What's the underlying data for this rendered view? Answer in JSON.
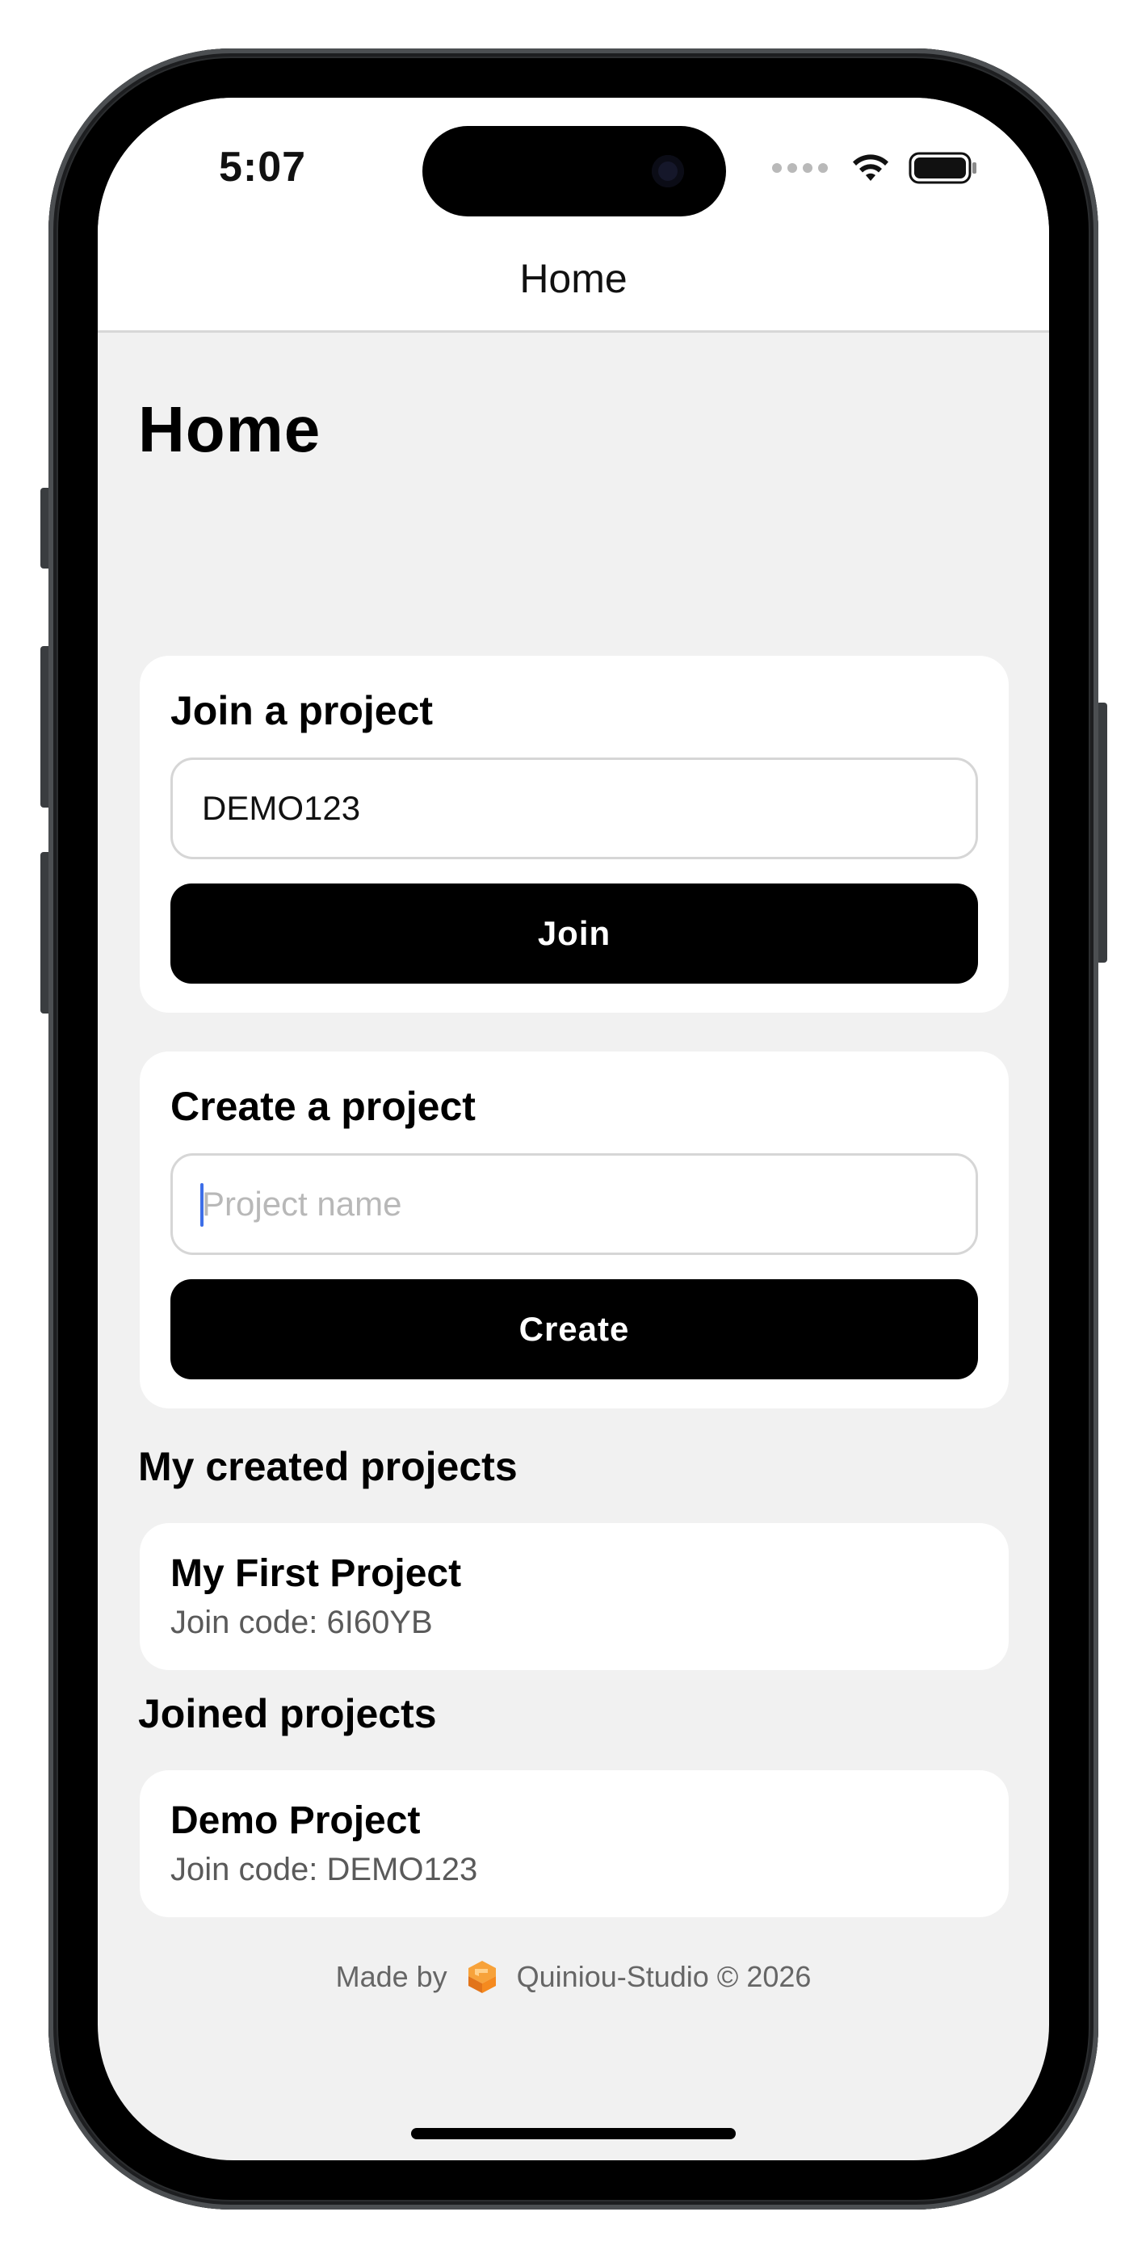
{
  "status_bar": {
    "time": "5:07"
  },
  "nav": {
    "title": "Home"
  },
  "page": {
    "title": "Home"
  },
  "join_card": {
    "heading": "Join a project",
    "input_value": "DEMO123",
    "button_label": "Join"
  },
  "create_card": {
    "heading": "Create a project",
    "input_placeholder": "Project name",
    "button_label": "Create"
  },
  "created_section": {
    "heading": "My created projects",
    "items": [
      {
        "name": "My First Project",
        "code": "Join code: 6I60YB"
      }
    ]
  },
  "joined_section": {
    "heading": "Joined projects",
    "items": [
      {
        "name": "Demo Project",
        "code": "Join code: DEMO123"
      }
    ]
  },
  "footer": {
    "made_by": "Made by",
    "studio": "Quiniou-Studio © 2026"
  },
  "colors": {
    "background": "#f1f1f1",
    "card": "#ffffff",
    "button": "#000000",
    "caret": "#3d6ee8",
    "logo": "#f58a1f"
  }
}
